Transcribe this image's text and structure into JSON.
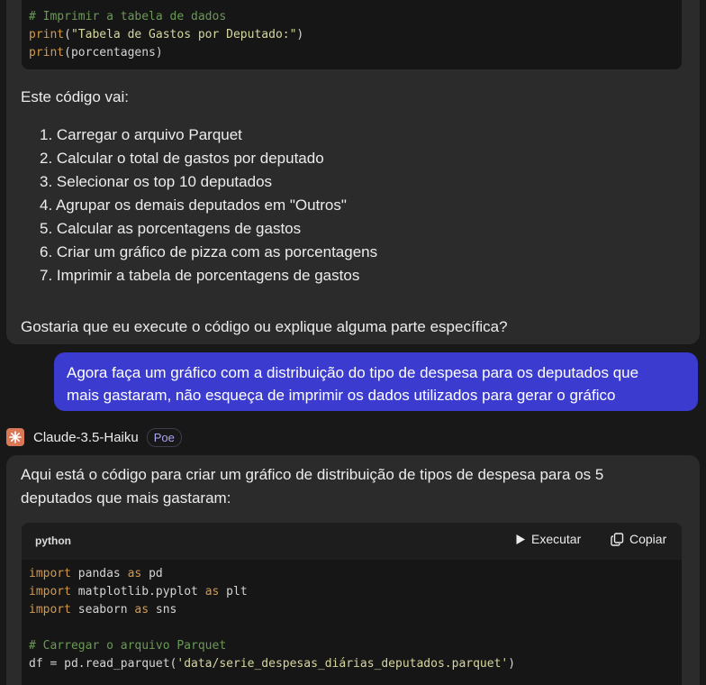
{
  "first_message": {
    "code_lines": [
      {
        "comment": "# Imprimir a tabela de dados"
      },
      {
        "fn": "print",
        "open": "(",
        "str": "\"Tabela de Gastos por Deputado:\"",
        "close": ")"
      },
      {
        "fn": "print",
        "open": "(",
        "plain": "porcentagens",
        "close": ")"
      }
    ],
    "intro": "Este código vai:",
    "steps": [
      "1. Carregar o arquivo Parquet",
      "2. Calcular o total de gastos por deputado",
      "3. Selecionar os top 10 deputados",
      "4. Agrupar os demais deputados em \"Outros\"",
      "5. Calcular as porcentagens de gastos",
      "6. Criar um gráfico de pizza com as porcentagens",
      "7. Imprimir a tabela de porcentagens de gastos"
    ],
    "closing": "Gostaria que eu execute o código ou explique alguma parte específica?"
  },
  "user_message": {
    "line1": "Agora faça um gráfico com a distribuição do tipo de despesa para os deputados que",
    "line2": "mais gastaram, não esqueça de imprimir os dados utilizados para gerar o gráfico"
  },
  "bot": {
    "name": "Claude-3.5-Haiku",
    "badge": "Poe",
    "avatar_icon": "claude-sparkle-icon"
  },
  "second_message": {
    "intro_line1": "Aqui está o código para criar um gráfico de distribuição de tipos de despesa para os 5",
    "intro_line2": "deputados que mais gastaram:",
    "code_language": "python",
    "run_label": "Executar",
    "copy_label": "Copiar",
    "code": {
      "l1_kw": "import",
      "l1_a": " pandas ",
      "l1_kw2": "as",
      "l1_b": " pd",
      "l2_kw": "import",
      "l2_a": " matplotlib.pyplot ",
      "l2_kw2": "as",
      "l2_b": " plt",
      "l3_kw": "import",
      "l3_a": " seaborn ",
      "l3_kw2": "as",
      "l3_b": " sns",
      "l5_comment": "# Carregar o arquivo Parquet",
      "l6_a": "df = pd.read_parquet(",
      "l6_str": "'data/serie_despesas_diárias_deputados.parquet'",
      "l6_b": ")"
    }
  },
  "colors": {
    "background": "#181818",
    "bubble": "#2b2b2b",
    "code_bg": "#161616",
    "user_bubble": "#3b3bd0",
    "accent_badge": "#a9a6f0",
    "avatar": "#d97757"
  }
}
